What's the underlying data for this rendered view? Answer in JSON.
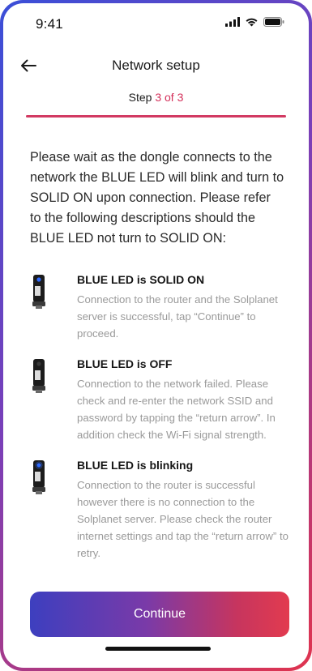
{
  "status_bar": {
    "time": "9:41"
  },
  "header": {
    "title": "Network setup"
  },
  "stepper": {
    "prefix": "Step ",
    "current": "3 of 3"
  },
  "intro": "Please wait as the dongle connects to the network the BLUE LED will blink and turn to SOLID ON upon connection. Please refer to the following descriptions should the BLUE LED not turn to SOLID ON:",
  "items": [
    {
      "title": "BLUE LED is SOLID ON",
      "description": "Connection to the router and the Solplanet server is successful, tap “Continue” to proceed."
    },
    {
      "title": "BLUE LED is OFF",
      "description": "Connection to the network failed. Please check and re-enter the network SSID and password by tapping the “return arrow”. In addition check the Wi-Fi signal strength."
    },
    {
      "title": "BLUE LED is blinking",
      "description": "Connection to the router is successful however there is no connection to the Solplanet server. Please check the router internet settings and tap the “return arrow” to retry."
    }
  ],
  "continue_label": "Continue",
  "icons": [
    "signal-icon",
    "wifi-icon",
    "battery-icon",
    "back-arrow-icon",
    "dongle-led-on-icon",
    "dongle-led-off-icon",
    "dongle-led-blinking-icon"
  ],
  "colors": {
    "accent": "#d4305a",
    "led_blue": "#2f6bff"
  }
}
